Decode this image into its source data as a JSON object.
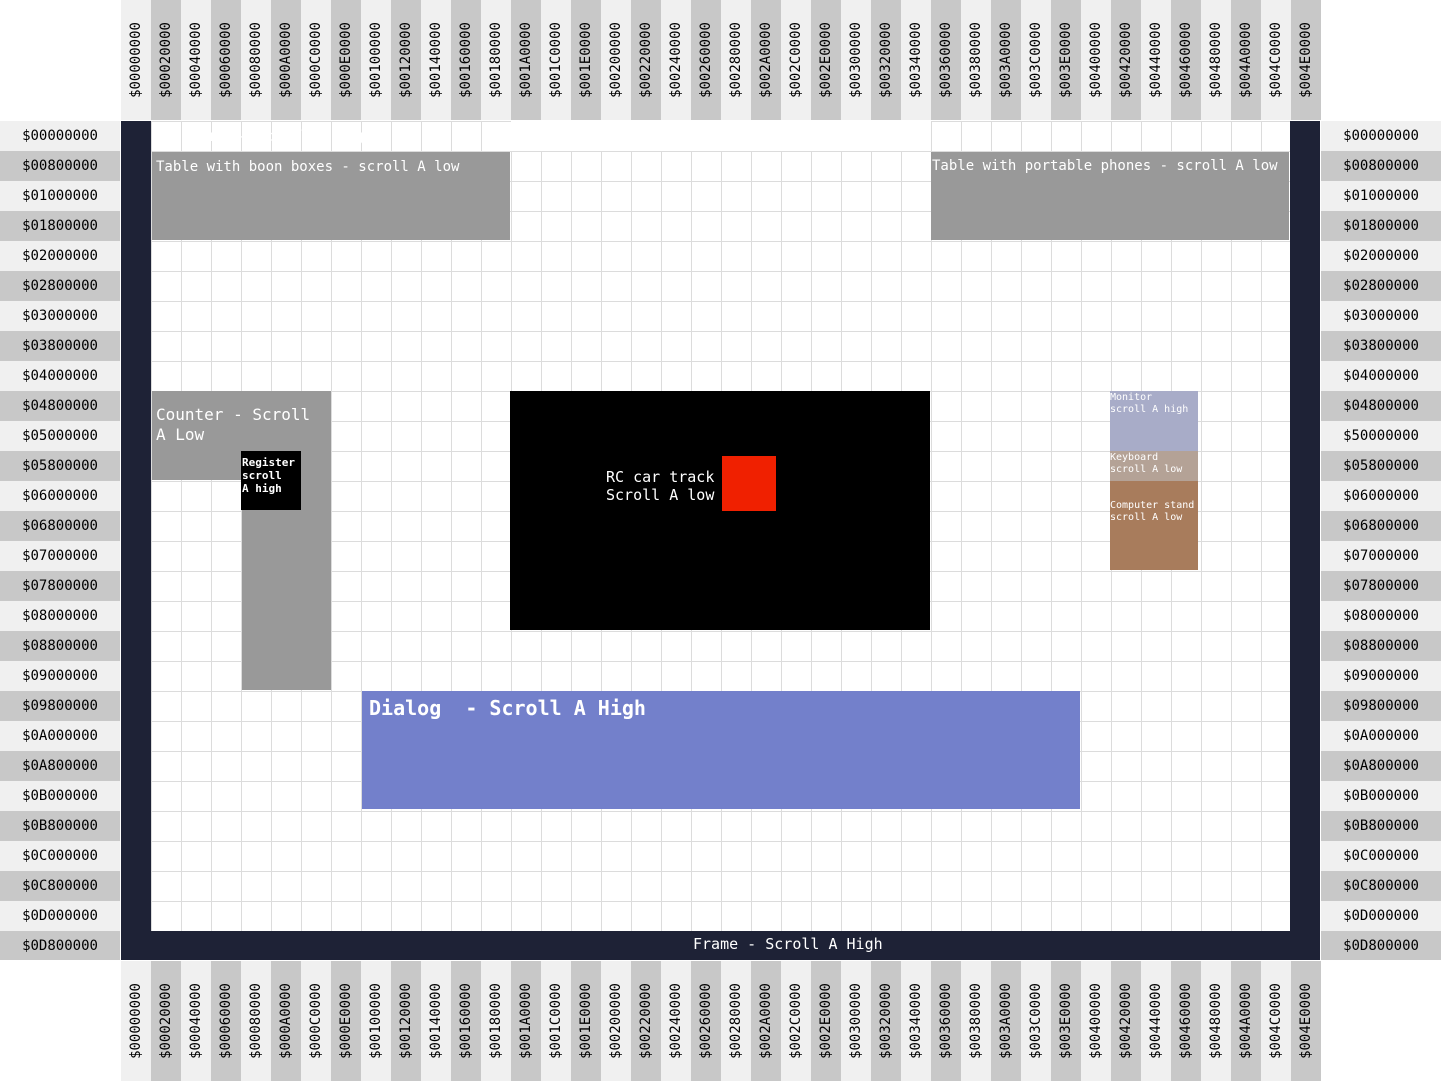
{
  "column_labels": [
    "$00000000",
    "$00020000",
    "$00040000",
    "$00060000",
    "$00080000",
    "$000A0000",
    "$000C0000",
    "$000E0000",
    "$00100000",
    "$00120000",
    "$00140000",
    "$00160000",
    "$00180000",
    "$001A0000",
    "$001C0000",
    "$001E0000",
    "$00200000",
    "$00220000",
    "$00240000",
    "$00260000",
    "$00280000",
    "$002A0000",
    "$002C0000",
    "$002E0000",
    "$00300000",
    "$00320000",
    "$00340000",
    "$00360000",
    "$00380000",
    "$003A0000",
    "$003C0000",
    "$003E0000",
    "$00400000",
    "$00420000",
    "$00440000",
    "$00460000",
    "$00480000",
    "$004A0000",
    "$004C0000",
    "$004E0000"
  ],
  "left_row_labels": [
    "$00000000",
    "$00800000",
    "$01000000",
    "$01800000",
    "$02000000",
    "$02800000",
    "$03000000",
    "$03800000",
    "$04000000",
    "$04800000",
    "$05000000",
    "$05800000",
    "$06000000",
    "$06800000",
    "$07000000",
    "$07800000",
    "$08000000",
    "$08800000",
    "$09000000",
    "$09800000",
    "$0A000000",
    "$0A800000",
    "$0B000000",
    "$0B800000",
    "$0C000000",
    "$0C800000",
    "$0D000000",
    "$0D800000"
  ],
  "right_row_labels": [
    "$00000000",
    "$00800000",
    "$01000000",
    "$01800000",
    "$02000000",
    "$02800000",
    "$03000000",
    "$03800000",
    "$04000000",
    "$04800000",
    "$50000000",
    "$05800000",
    "$06000000",
    "$06800000",
    "$07000000",
    "$07800000",
    "$08000000",
    "$08800000",
    "$09000000",
    "$09800000",
    "$0A000000",
    "$0A800000",
    "$0B000000",
    "$0B800000",
    "$0C000000",
    "$0C800000",
    "$0D000000",
    "$0D800000"
  ],
  "regions": {
    "frame_top": "Frame - Scroll A High",
    "frame_bottom": "Frame - Scroll A High",
    "table_boom": "Table with boon boxes - scroll A low",
    "table_phones": "Table with portable phones - scroll A low",
    "counter": "Counter - Scroll\nA Low",
    "register": "Register\nscroll\nA high",
    "rc_track": "RC car track\nScroll A low",
    "monitor": "Monitor\nscroll A high",
    "keyboard": "Keyboard\nscroll A low",
    "computer_stand": "Computer stand\nscroll A low",
    "dialog": "Dialog  - Scroll A High"
  },
  "colors": {
    "frame": "#1e2236",
    "table": "#999999",
    "counter": "#999999",
    "register": "#000000",
    "rc_track": "#000000",
    "rc_car": "#f02000",
    "monitor": "#a8acc8",
    "keyboard": "#b4a296",
    "computer_stand": "#a87c5c",
    "dialog": "#7380cb",
    "label_light": "#f0f0f0",
    "label_dark": "#c8c8c8"
  }
}
